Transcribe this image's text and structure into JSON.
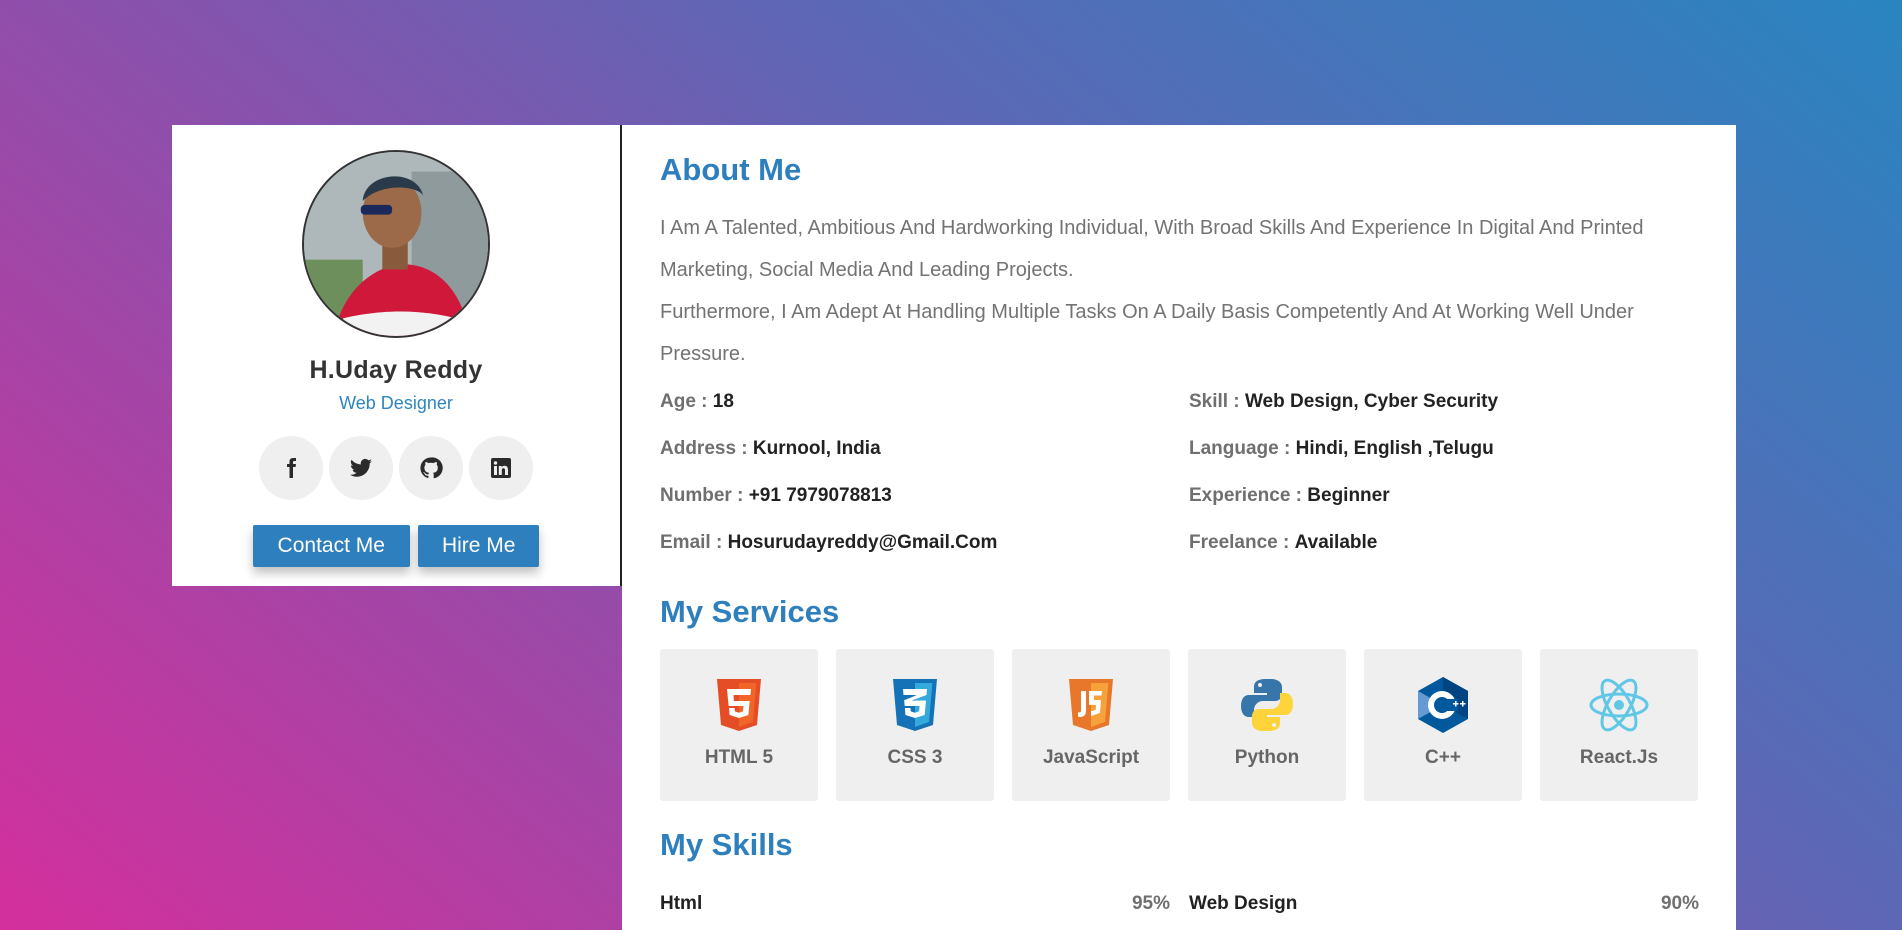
{
  "profile": {
    "name": "H.Uday Reddy",
    "role": "Web Designer",
    "socials": [
      {
        "icon": "facebook-icon"
      },
      {
        "icon": "twitter-icon"
      },
      {
        "icon": "github-icon"
      },
      {
        "icon": "linkedin-icon"
      }
    ],
    "contact_label": "Contact Me",
    "hire_label": "Hire Me"
  },
  "about": {
    "title": "About Me",
    "paragraph1": "I Am A Talented, Ambitious And Hardworking Individual, With Broad Skills And Experience In Digital And Printed Marketing, Social Media And Leading Projects.",
    "paragraph2": "Furthermore, I Am Adept At Handling Multiple Tasks On A Daily Basis Competently And At Working Well Under Pressure.",
    "info": [
      {
        "label": "Age :",
        "value": "18"
      },
      {
        "label": "Skill :",
        "value": "Web Design, Cyber Security"
      },
      {
        "label": "Address :",
        "value": "Kurnool, India"
      },
      {
        "label": "Language :",
        "value": "Hindi, English ,Telugu"
      },
      {
        "label": "Number :",
        "value": "+91 7979078813"
      },
      {
        "label": "Experience :",
        "value": "Beginner"
      },
      {
        "label": "Email :",
        "value": "Hosurudayreddy@Gmail.Com"
      },
      {
        "label": "Freelance :",
        "value": "Available"
      }
    ]
  },
  "services": {
    "title": "My Services",
    "items": [
      {
        "label": "HTML 5",
        "icon": "html5-icon",
        "color": "#e44d26"
      },
      {
        "label": "CSS 3",
        "icon": "css3-icon",
        "color": "#1572b6"
      },
      {
        "label": "JavaScript",
        "icon": "javascript-icon",
        "color": "#f0812a"
      },
      {
        "label": "Python",
        "icon": "python-icon",
        "color": "#3776ab"
      },
      {
        "label": "C++",
        "icon": "cplusplus-icon",
        "color": "#00599c"
      },
      {
        "label": "React.Js",
        "icon": "react-icon",
        "color": "#61dafb"
      }
    ]
  },
  "skills": {
    "title": "My Skills",
    "items": [
      {
        "name": "Html",
        "percent": "95%"
      },
      {
        "name": "Web Design",
        "percent": "90%"
      }
    ]
  },
  "colors": {
    "accent": "#2e7fbd",
    "card_bg": "#efefef"
  }
}
